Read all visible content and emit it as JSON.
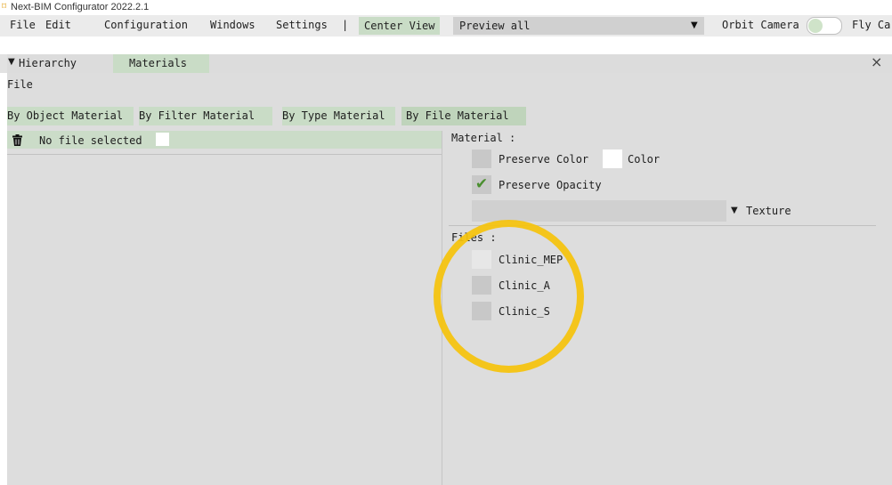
{
  "window": {
    "title": "Next-BIM Configurator 2022.2.1",
    "app_icon_glyph": "⌑"
  },
  "menubar": {
    "items": [
      "File",
      "Edit",
      "Configuration",
      "Windows",
      "Settings"
    ],
    "separator": "|",
    "center_view_label": "Center View",
    "preview_select_value": "Preview all",
    "orbit_camera_label": "Orbit Camera",
    "fly_camera_label": "Fly Ca",
    "dropdown_arrow": "▼"
  },
  "panel": {
    "collapse_glyph": "▼",
    "tabs": [
      "Hierarchy",
      "Materials"
    ],
    "active_tab": "Materials",
    "close_glyph": "×",
    "section_label": "File",
    "subtabs": [
      "By Object Material",
      "By Filter Material",
      "By Type Material",
      "By File Material"
    ],
    "active_subtab": "By File Material"
  },
  "left_pane": {
    "file_label": "No file selected"
  },
  "material": {
    "heading": "Material :",
    "preserve_color_label": "Preserve Color",
    "preserve_color_checked": false,
    "color_label": "Color",
    "preserve_opacity_label": "Preserve Opacity",
    "preserve_opacity_checked": true,
    "checkmark_glyph": "✔",
    "texture_label": "Texture",
    "texture_value": ""
  },
  "files": {
    "heading": "Files :",
    "items": [
      {
        "name": "Clinic_MEP",
        "checked": false
      },
      {
        "name": "Clinic_A",
        "checked": false
      },
      {
        "name": "Clinic_S",
        "checked": false
      }
    ]
  },
  "colors": {
    "accent_green": "#c9dcc6",
    "panel_bg": "#dddddd",
    "highlight_ring": "#f5c30c",
    "checkmark": "#4a8f2f"
  },
  "icons": [
    "trash-icon",
    "collapse-arrow-icon",
    "close-icon",
    "dropdown-arrow-icon",
    "checkmark-icon"
  ]
}
